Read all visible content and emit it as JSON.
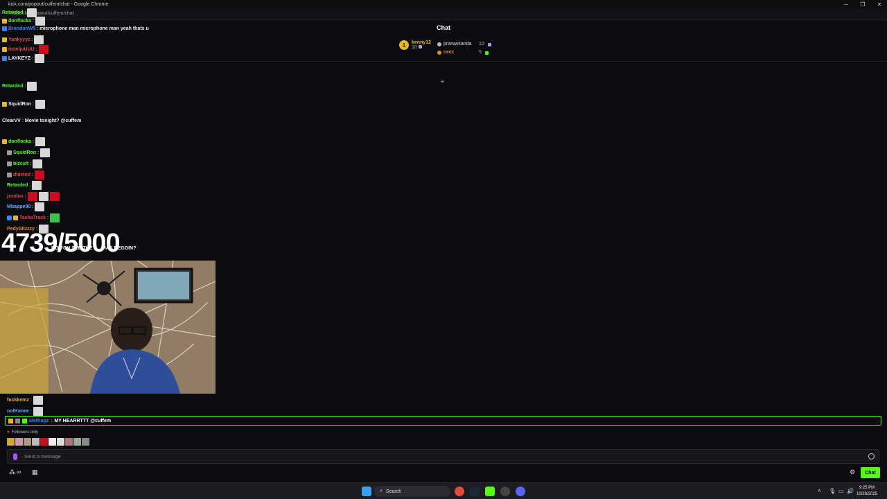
{
  "window": {
    "title": "kick.com/popout/cuffem/chat - Google Chrome",
    "url": "kick.com/popout/cuffem/chat",
    "controls": {
      "minimize": "─",
      "maximize": "❐",
      "close": "✕"
    }
  },
  "header": {
    "title": "Chat",
    "leaderboard": {
      "first": {
        "rank": "1",
        "name": "kenny12",
        "count": "10"
      },
      "rest": [
        {
          "name": "pranavkanda",
          "count": "10"
        },
        {
          "name": "ceez",
          "count": "5"
        }
      ]
    }
  },
  "chat": {
    "messages": [
      {
        "user": "Retarded",
        "color": "#53fc18",
        "text": "",
        "emotes": [
          "big"
        ],
        "badges": []
      },
      {
        "user": "donflocka",
        "color": "#53fc18",
        "text": "",
        "emotes": [
          "big"
        ],
        "badges": [
          "b3"
        ]
      },
      {
        "user": "BrandonW5",
        "color": "#3b82f6",
        "text": "microphone man microphone man yeah thats u",
        "emotes": [],
        "badges": [
          "b2"
        ]
      },
      {
        "user": "Yankyyyz",
        "color": "#e6464d",
        "text": "",
        "emotes": [
          "big"
        ],
        "badges": [
          "b3"
        ]
      },
      {
        "user": "itsteljuUUU",
        "color": "#e6464d",
        "text": "",
        "emotes": [
          "red"
        ],
        "badges": [
          "b3"
        ]
      },
      {
        "user": "LAYKEYZ",
        "color": "#f2f2f2",
        "text": "",
        "emotes": [
          "big"
        ],
        "badges": [
          "b2"
        ]
      },
      {
        "user": "Retarded",
        "color": "#53fc18",
        "text": "",
        "emotes": [
          "big"
        ],
        "badges": []
      },
      {
        "user": "SquidRon",
        "color": "#f2f2f2",
        "text": "",
        "emotes": [
          "big"
        ],
        "badges": [
          "b3"
        ]
      },
      {
        "user": "ClearVV",
        "color": "#f2f2f2",
        "text": "Movie tonight? @cuffem",
        "emotes": [],
        "badges": []
      },
      {
        "user": "donflocka",
        "color": "#53fc18",
        "text": "",
        "emotes": [
          "big"
        ],
        "badges": [
          "b3"
        ]
      },
      {
        "user": "SquidRon",
        "color": "#53fc18",
        "text": "",
        "emotes": [
          "big"
        ],
        "badges": [
          "b4"
        ]
      },
      {
        "user": "bizcult",
        "color": "#53fc18",
        "text": "",
        "emotes": [
          "big"
        ],
        "badges": [
          "b4"
        ]
      },
      {
        "user": "dhieted",
        "color": "#e6464d",
        "text": "",
        "emotes": [
          "red"
        ],
        "badges": [
          "b4"
        ]
      },
      {
        "user": "Retarded",
        "color": "#53fc18",
        "text": "",
        "emotes": [
          "big"
        ],
        "badges": []
      },
      {
        "user": "jxsalux",
        "color": "#e6464d",
        "text": "",
        "emotes": [
          "red",
          "big",
          "red"
        ],
        "badges": []
      },
      {
        "user": "Mbappe90",
        "color": "#6aa6ff",
        "text": "",
        "emotes": [
          "big"
        ],
        "badges": []
      },
      {
        "user": "TashaTrack",
        "color": "#e6464d",
        "text": "",
        "emotes": [
          "grn"
        ],
        "badges": [
          "b2",
          "b3"
        ]
      },
      {
        "user": "PedyStizzzy",
        "color": "#e58a2b",
        "text": "",
        "emotes": [
          "big"
        ],
        "badges": []
      },
      {
        "user": "fuckkemz",
        "color": "#e6b62b",
        "text": "",
        "emotes": [
          "big"
        ],
        "badges": []
      },
      {
        "user": "notKanee",
        "color": "#6aa6ff",
        "text": "",
        "emotes": [
          "big"
        ],
        "badges": []
      }
    ],
    "pinned": {
      "user": "alethugz",
      "text": "MY HEARRTTT @cuffem"
    },
    "followers_only": "Followers only",
    "input_placeholder": "Send a message",
    "send_label": "Chat"
  },
  "overlay": {
    "goal": "4739/5000",
    "subtext": "DO YOU SEE THE S... HAS BEGGIN?"
  },
  "taskbar": {
    "search_label": "Search",
    "time": "9:25 PM",
    "date": "10/28/2025"
  },
  "colors": {
    "accent": "#53fc18",
    "background": "#0b0c0f"
  }
}
